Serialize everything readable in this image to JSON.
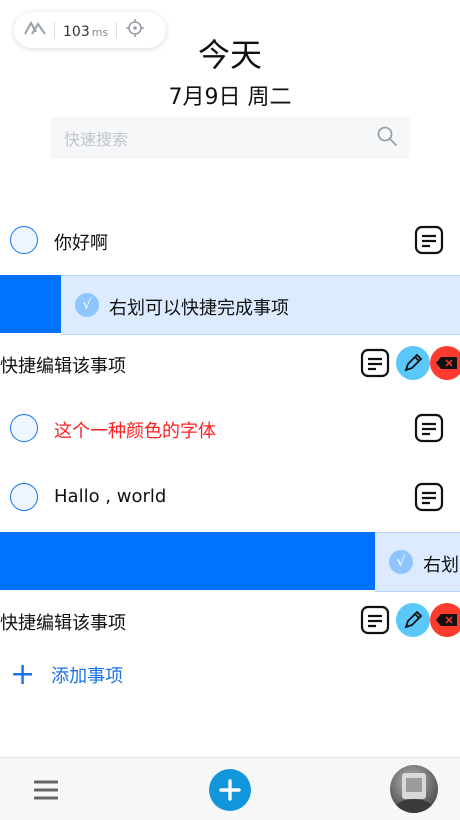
{
  "perf": {
    "value": "103",
    "unit": "ms"
  },
  "header": {
    "title": "今天",
    "date": "7月9日 周二"
  },
  "search": {
    "placeholder": "快速搜索"
  },
  "tasks": [
    {
      "text": "你好啊"
    },
    {
      "text": "右划可以快捷完成事项",
      "state": "swiped-done"
    },
    {
      "text": "快捷编辑该事项",
      "state": "swiped-edit"
    },
    {
      "text": "这个一种颜色的字体",
      "color": "#ff2020"
    },
    {
      "text": "Hallo , world"
    },
    {
      "text": "右划",
      "state": "swiped-done-partial"
    },
    {
      "text": "快捷编辑该事项",
      "state": "swiped-edit"
    }
  ],
  "add": {
    "label": "添加事项"
  },
  "colors": {
    "primary": "#0072ff",
    "accent": "#1a73e8",
    "delete": "#ff3b30",
    "edit": "#5ac8fa",
    "fab": "#1296db"
  },
  "icons": {
    "perf": [
      "logo-icon",
      "crosshair-icon"
    ],
    "search": "search-icon",
    "note": "note-icon",
    "check": "check-icon",
    "edit": "pencil-icon",
    "delete": "delete-icon",
    "menu": "menu-icon",
    "add": "plus-icon",
    "avatar": "avatar"
  }
}
